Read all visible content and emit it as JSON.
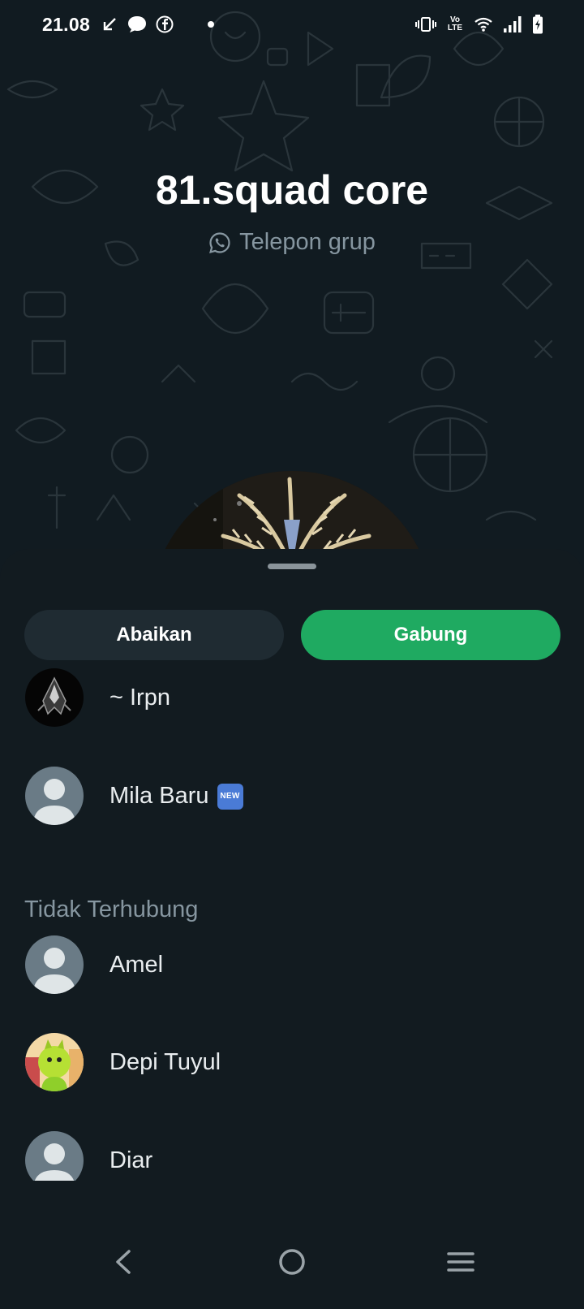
{
  "status_bar": {
    "time": "21.08",
    "left_icons": [
      "missed-call-arrow-icon",
      "chat-bubble-icon",
      "facebook-icon",
      "dot-icon"
    ],
    "right_icons": [
      "vibrate-icon",
      "volte-icon",
      "wifi-icon",
      "signal-icon",
      "battery-icon"
    ],
    "volte_label": "Vo LTE"
  },
  "call": {
    "title": "81.squad core",
    "subtitle": "Telepon grup"
  },
  "actions": {
    "ignore_label": "Abaikan",
    "join_label": "Gabung"
  },
  "participants": [
    {
      "name": "~ Irpn",
      "avatar": "dark-emblem-avatar"
    },
    {
      "name": "Mila Baru",
      "avatar": "default-avatar",
      "badge": "NEW"
    }
  ],
  "disconnected": {
    "header": "Tidak Terhubung",
    "members": [
      {
        "name": "Amel",
        "avatar": "default-avatar"
      },
      {
        "name": "Depi Tuyul",
        "avatar": "cartoon-avatar"
      },
      {
        "name": "Diar",
        "avatar": "default-avatar"
      }
    ]
  },
  "colors": {
    "accent_green": "#1faa61",
    "sheet_background": "#121b20",
    "secondary_text": "#8696a0"
  },
  "nav_bar": {
    "icons": [
      "back-icon",
      "home-icon",
      "recents-icon"
    ]
  }
}
